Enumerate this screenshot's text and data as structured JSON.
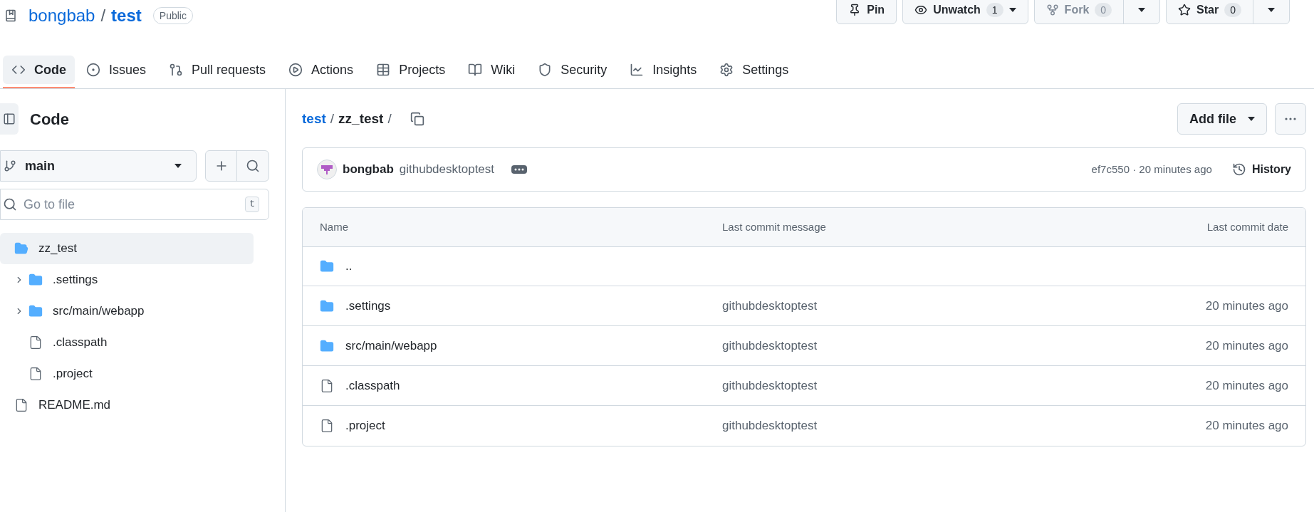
{
  "repo": {
    "owner": "bongbab",
    "separator": "/",
    "name": "test",
    "visibility": "Public"
  },
  "actions": [
    {
      "kind": "pin",
      "label": "Pin",
      "disabled": false
    },
    {
      "kind": "watch",
      "label": "Unwatch",
      "count": "1",
      "disabled": false
    },
    {
      "kind": "fork",
      "label": "Fork",
      "count": "0",
      "disabled": true
    },
    {
      "kind": "star",
      "label": "Star",
      "count": "0",
      "disabled": false
    }
  ],
  "tabs": [
    {
      "kind": "code",
      "label": "Code",
      "selected": true
    },
    {
      "kind": "issues",
      "label": "Issues",
      "selected": false
    },
    {
      "kind": "pulls",
      "label": "Pull requests",
      "selected": false
    },
    {
      "kind": "actions",
      "label": "Actions",
      "selected": false
    },
    {
      "kind": "projects",
      "label": "Projects",
      "selected": false
    },
    {
      "kind": "wiki",
      "label": "Wiki",
      "selected": false
    },
    {
      "kind": "security",
      "label": "Security",
      "selected": false
    },
    {
      "kind": "insights",
      "label": "Insights",
      "selected": false
    },
    {
      "kind": "settings",
      "label": "Settings",
      "selected": false
    }
  ],
  "sidebar": {
    "title": "Code",
    "branch": "main",
    "search": {
      "placeholder": "Go to file",
      "shortcut": "t"
    },
    "tree": [
      {
        "kind": "folder",
        "name": "zz_test",
        "expanded": true,
        "selected": true,
        "children": [
          {
            "kind": "folder",
            "name": ".settings",
            "expanded": false,
            "selected": false
          },
          {
            "kind": "folder",
            "name": "src/main/webapp",
            "expanded": false,
            "selected": false
          },
          {
            "kind": "file",
            "name": ".classpath",
            "selected": false
          },
          {
            "kind": "file",
            "name": ".project",
            "selected": false
          }
        ]
      },
      {
        "kind": "file",
        "name": "README.md",
        "selected": false
      }
    ]
  },
  "breadcrumb": {
    "separator": "/",
    "parts": [
      "test",
      "zz_test"
    ]
  },
  "add_file": "Add file",
  "commit": {
    "author": "bongbab",
    "message": "githubdesktoptest",
    "hash_time": "ef7c550 · 20 minutes ago",
    "history": "History"
  },
  "table": {
    "columns": [
      "Name",
      "Last commit message",
      "Last commit date"
    ],
    "parent": "..",
    "rows": [
      {
        "kind": "folder",
        "name": ".settings",
        "message": "githubdesktoptest",
        "date": "20 minutes ago"
      },
      {
        "kind": "folder",
        "name": "src/main/webapp",
        "message": "githubdesktoptest",
        "date": "20 minutes ago"
      },
      {
        "kind": "file",
        "name": ".classpath",
        "message": "githubdesktoptest",
        "date": "20 minutes ago"
      },
      {
        "kind": "file",
        "name": ".project",
        "message": "githubdesktoptest",
        "date": "20 minutes ago"
      }
    ]
  }
}
